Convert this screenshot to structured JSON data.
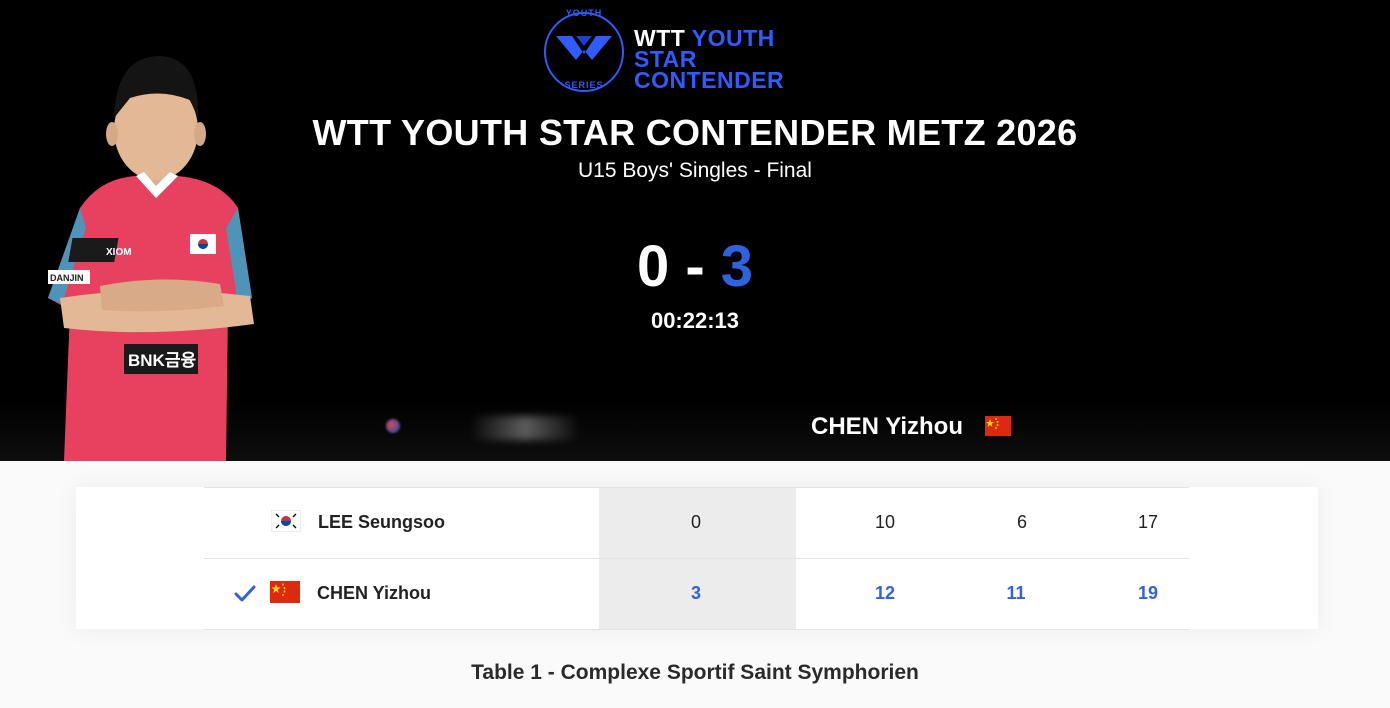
{
  "logo": {
    "ring_top": "YOUTH",
    "ring_bottom": "SERIES",
    "line1_a": "WTT",
    "line1_b": "YOUTH",
    "line2": "STAR CONTENDER"
  },
  "event": {
    "title": "WTT YOUTH STAR CONTENDER METZ 2026",
    "subtitle": "U15 Boys' Singles - Final"
  },
  "match": {
    "score_home": "0",
    "score_separator": "-",
    "score_away": "3",
    "elapsed": "00:22:13"
  },
  "banner": {
    "away_name": "CHEN Yizhou"
  },
  "player_photo_text": {
    "chest_logo": "XIOM",
    "sleeve": "DANJIN",
    "sponsor": "BNK금융"
  },
  "results": [
    {
      "name": "LEE Seungsoo",
      "flag": "korea-flag-icon",
      "winner": false,
      "games": "0",
      "sets": [
        "10",
        "6",
        "17"
      ]
    },
    {
      "name": "CHEN Yizhou",
      "flag": "china-flag-icon",
      "winner": true,
      "games": "3",
      "sets": [
        "12",
        "11",
        "19"
      ]
    }
  ],
  "venue": "Table 1 - Complexe Sportif Saint Symphorien",
  "colors": {
    "accent": "#2f62e0",
    "logo_blue": "#2f5bff",
    "hero_bg": "#000000",
    "jersey": "#e8405f"
  }
}
